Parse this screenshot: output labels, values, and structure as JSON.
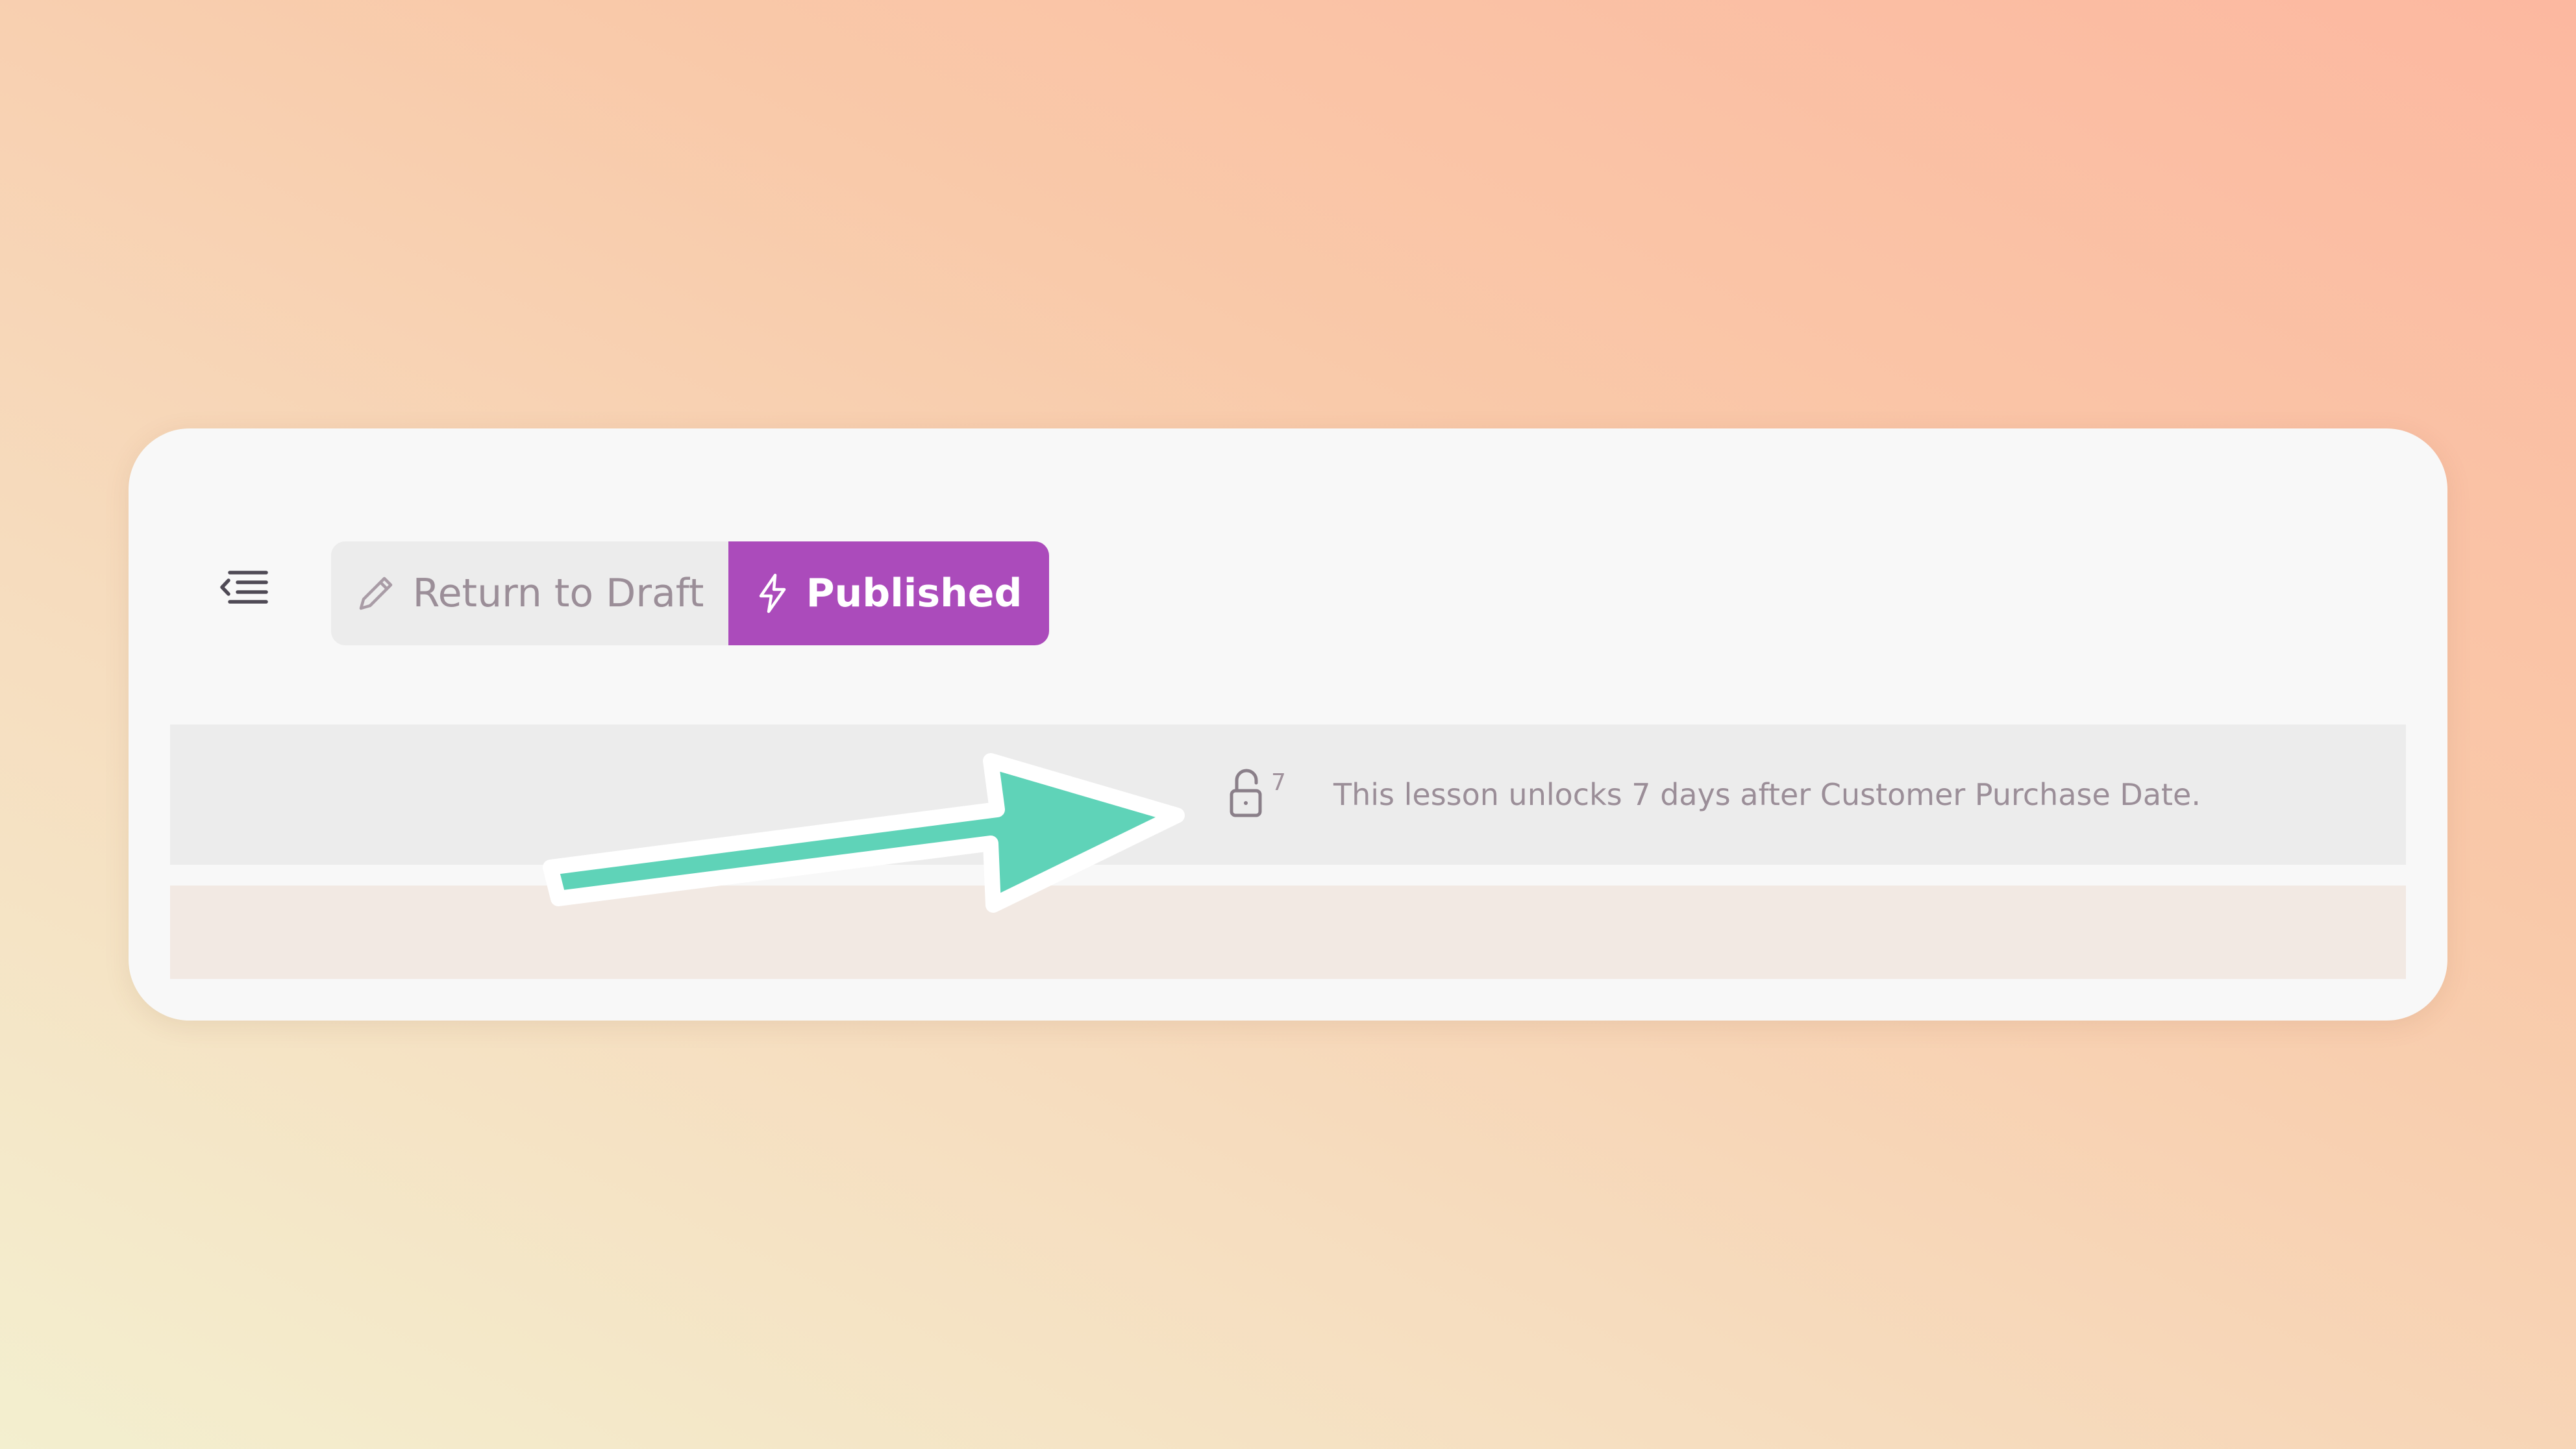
{
  "toolbar": {
    "sidebar_toggle_icon": "collapse-sidebar-icon",
    "return_to_draft_label": "Return to Draft",
    "return_to_draft_icon": "pencil-icon",
    "published_label": "Published",
    "published_icon": "lightning-icon"
  },
  "lesson_drip": {
    "lock_icon": "unlock-icon",
    "unlock_days": "7",
    "message": "This lesson unlocks 7 days after Customer Purchase Date."
  },
  "annotation": {
    "arrow_icon": "callout-arrow-icon"
  },
  "colors": {
    "published_accent": "#ab4bbb",
    "arrow_fill": "#5fd3b8",
    "muted_text": "#9b8e98",
    "card_background": "#f8f8f8"
  }
}
